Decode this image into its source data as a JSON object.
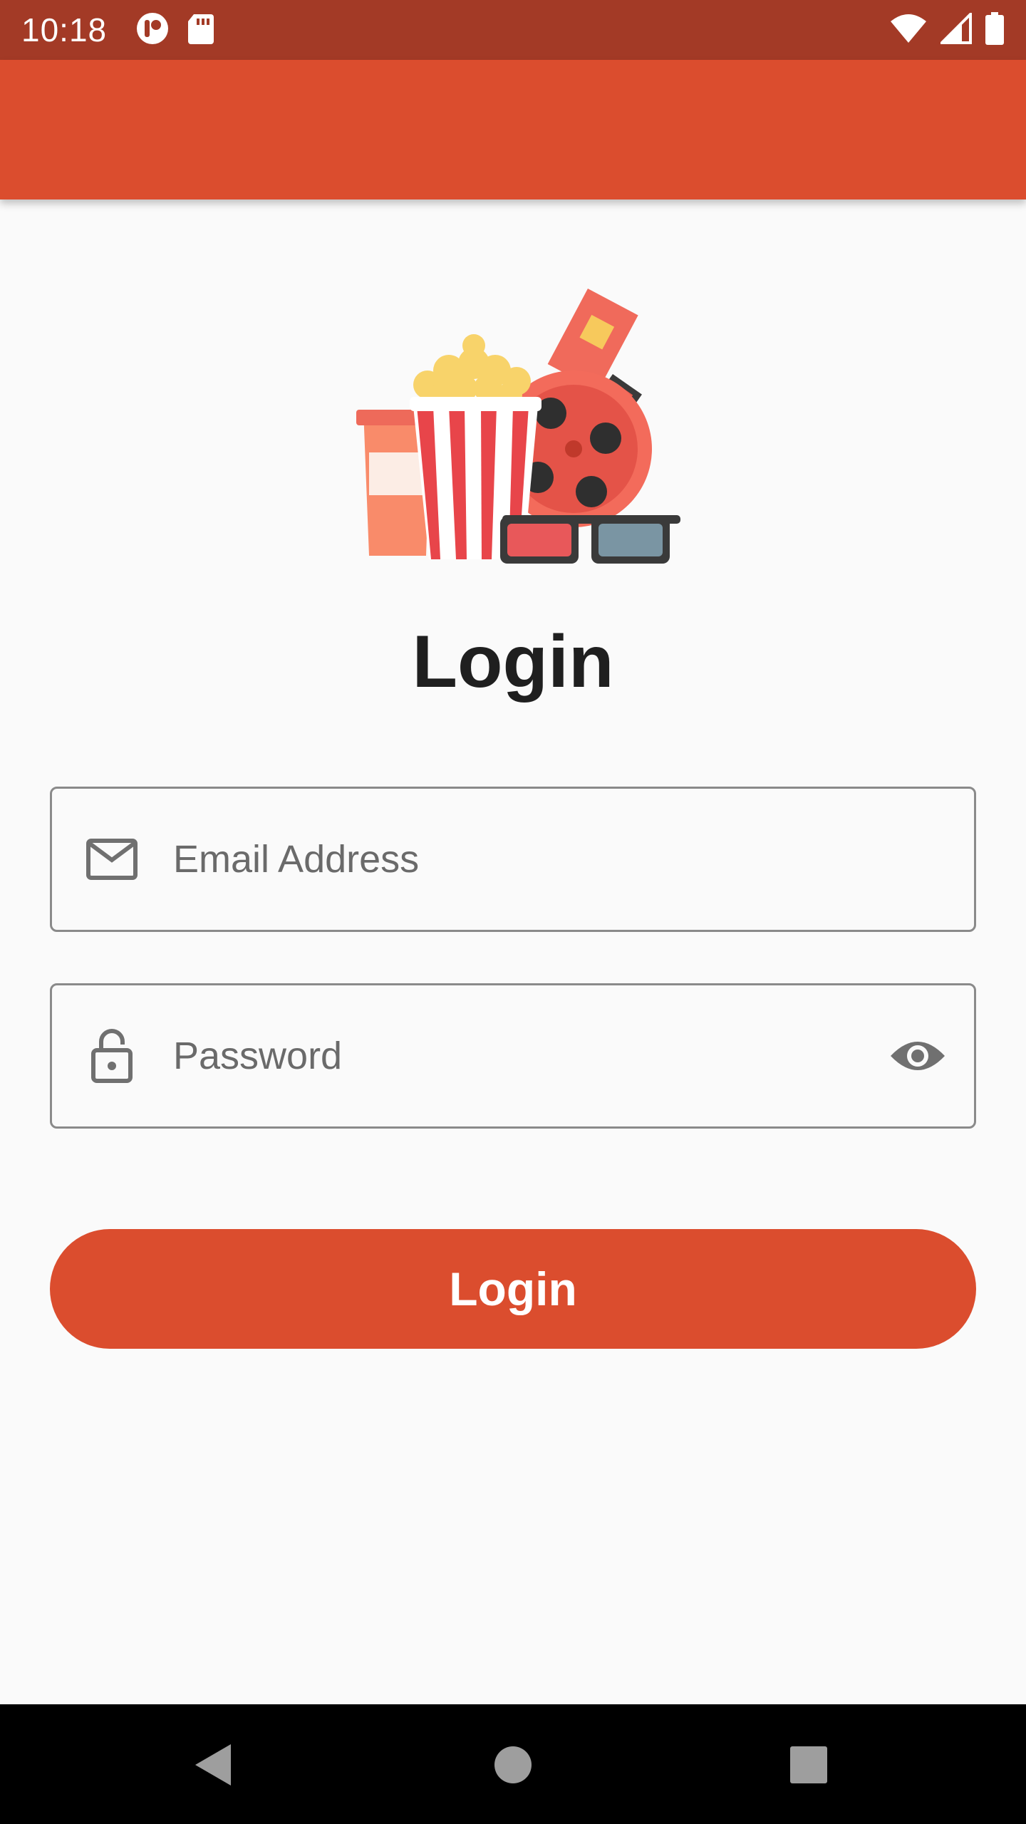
{
  "status_bar": {
    "time": "10:18"
  },
  "page": {
    "title": "Login"
  },
  "form": {
    "email": {
      "placeholder": "Email Address",
      "value": ""
    },
    "password": {
      "placeholder": "Password",
      "value": ""
    },
    "submit_label": "Login"
  },
  "icons": {
    "email": "mail-icon",
    "password": "lock-icon",
    "visibility": "eye-icon"
  },
  "colors": {
    "primary": "#DB4D2E",
    "status_bar": "#A33A26",
    "background": "#FAFAFA"
  }
}
